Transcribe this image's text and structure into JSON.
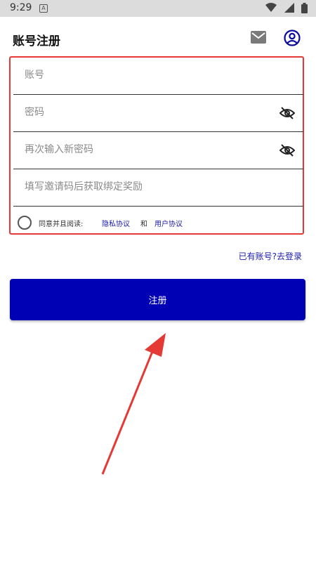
{
  "status_bar": {
    "time": "9:29",
    "notification_letter": "A"
  },
  "header": {
    "title": "账号注册",
    "mail_icon": "mail-icon",
    "user_icon": "account-circle-icon"
  },
  "form": {
    "account_placeholder": "账号",
    "password_placeholder": "密码",
    "confirm_password_placeholder": "再次输入新密码",
    "invite_code_placeholder": "填写邀请码后获取绑定奖励",
    "agree_text": "同意并且阅读:",
    "privacy_link": "隐私协议",
    "and_text": "和",
    "user_agreement_link": "用户协议"
  },
  "login_link": "已有账号?去登录",
  "register_button": "注册",
  "colors": {
    "accent": "#0000b4",
    "highlight_border": "#e53935",
    "arrow": "#e53935"
  }
}
